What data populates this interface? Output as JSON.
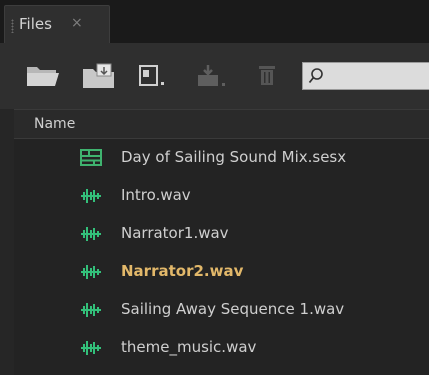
{
  "panel": {
    "tab_label": "Files",
    "tab_close": "×"
  },
  "toolbar": {
    "buttons": [
      {
        "name": "open-folder-icon"
      },
      {
        "name": "import-file-icon"
      },
      {
        "name": "new-file-dropdown-icon"
      },
      {
        "name": "insert-into-multitrack-icon"
      },
      {
        "name": "delete-icon"
      }
    ],
    "search": {
      "value": "",
      "placeholder": ""
    }
  },
  "columns": {
    "name_header": "Name"
  },
  "files": [
    {
      "name": "Day of Sailing Sound Mix.sesx",
      "icon": "multitrack-session-icon",
      "highlight": false
    },
    {
      "name": "Intro.wav",
      "icon": "waveform-icon",
      "highlight": false
    },
    {
      "name": "Narrator1.wav",
      "icon": "waveform-icon",
      "highlight": false
    },
    {
      "name": "Narrator2.wav",
      "icon": "waveform-icon",
      "highlight": true
    },
    {
      "name": "Sailing Away Sequence 1.wav",
      "icon": "waveform-icon",
      "highlight": false
    },
    {
      "name": "theme_music.wav",
      "icon": "waveform-icon",
      "highlight": false
    }
  ],
  "colors": {
    "highlight_text": "#e2b86a",
    "waveform_icon": "#33c07a",
    "session_icon": "#3fb36f"
  }
}
